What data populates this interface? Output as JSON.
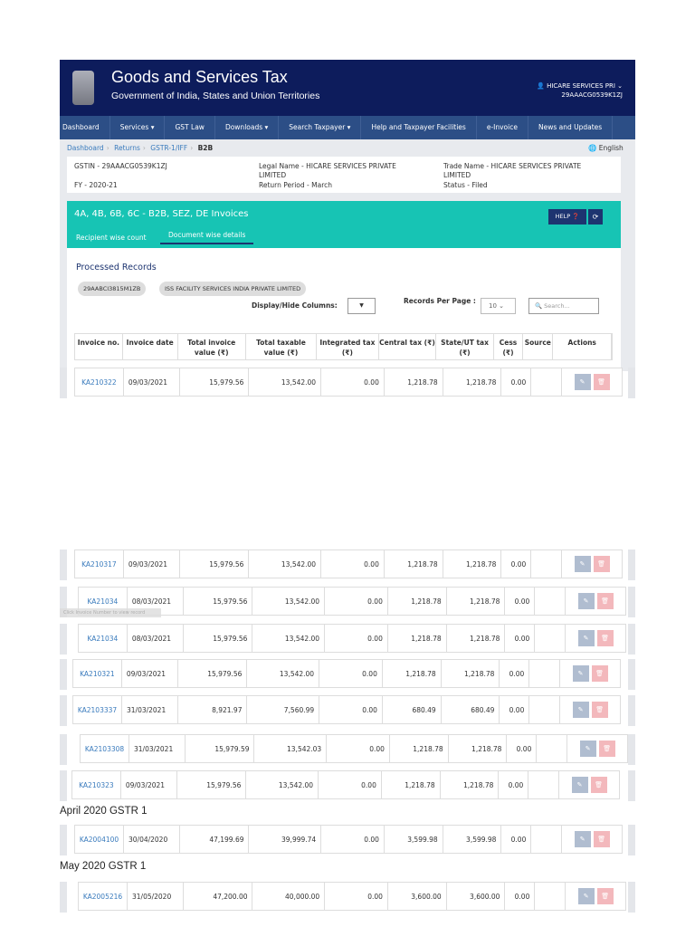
{
  "header": {
    "title": "Goods and Services Tax",
    "subtitle": "Government of India, States and Union Territories",
    "user_name": "HICARE SERVICES PRI ⌄",
    "user_gstin": "29AAACG0539K1ZJ"
  },
  "nav": [
    "Dashboard",
    "Services ▾",
    "GST Law",
    "Downloads ▾",
    "Search Taxpayer ▾",
    "Help and Taxpayer Facilities",
    "e-Invoice",
    "News and Updates"
  ],
  "breadcrumb": [
    "Dashboard",
    "Returns",
    "GSTR-1/IFF",
    "B2B"
  ],
  "language": "English",
  "info": {
    "gstin": "GSTIN - 29AAACG0539K1ZJ",
    "fy": "FY - 2020-21",
    "legal_name": "Legal Name - HICARE SERVICES PRIVATE LIMITED",
    "return_period": "Return Period - March",
    "trade_name": "Trade Name - HICARE SERVICES PRIVATE LIMITED",
    "status": "Status - Filed"
  },
  "panel": {
    "title": "4A, 4B, 6B, 6C - B2B, SEZ, DE Invoices",
    "help": "HELP ❓",
    "tabs": [
      "Recipient wise count",
      "Document wise details"
    ],
    "processed": "Processed Records",
    "chips": [
      "29AABCI3815M1ZB",
      "ISS FACILITY SERVICES INDIA PRIVATE LIMITED"
    ],
    "display_hide": "Display/Hide Columns:",
    "records_per_page": "Records Per Page :",
    "rpp_value": "10",
    "search_placeholder": "Search..."
  },
  "columns": [
    "Invoice no.",
    "Invoice date",
    "Total invoice value (₹)",
    "Total taxable value (₹)",
    "Integrated tax (₹)",
    "Central tax (₹)",
    "State/UT tax (₹)",
    "Cess (₹)",
    "Source",
    "Actions"
  ],
  "rows": [
    [
      "KA210322",
      "09/03/2021",
      "15,979.56",
      "13,542.00",
      "0.00",
      "1,218.78",
      "1,218.78",
      "0.00"
    ],
    [
      "KA210317",
      "09/03/2021",
      "15,979.56",
      "13,542.00",
      "0.00",
      "1,218.78",
      "1,218.78",
      "0.00"
    ],
    [
      "KA21034",
      "08/03/2021",
      "15,979.56",
      "13,542.00",
      "0.00",
      "1,218.78",
      "1,218.78",
      "0.00"
    ],
    [
      "KA21034",
      "08/03/2021",
      "15,979.56",
      "13,542.00",
      "0.00",
      "1,218.78",
      "1,218.78",
      "0.00"
    ],
    [
      "KA210321",
      "09/03/2021",
      "15,979.56",
      "13,542.00",
      "0.00",
      "1,218.78",
      "1,218.78",
      "0.00"
    ],
    [
      "KA2103337",
      "31/03/2021",
      "8,921.97",
      "7,560.99",
      "0.00",
      "680.49",
      "680.49",
      "0.00"
    ],
    [
      "KA2103308",
      "31/03/2021",
      "15,979.59",
      "13,542.03",
      "0.00",
      "1,218.78",
      "1,218.78",
      "0.00"
    ],
    [
      "KA210323",
      "09/03/2021",
      "15,979.56",
      "13,542.00",
      "0.00",
      "1,218.78",
      "1,218.78",
      "0.00"
    ],
    [
      "KA2004100",
      "30/04/2020",
      "47,199.69",
      "39,999.74",
      "0.00",
      "3,599.98",
      "3,599.98",
      "0.00"
    ],
    [
      "KA2005216",
      "31/05/2020",
      "47,200.00",
      "40,000.00",
      "0.00",
      "3,600.00",
      "3,600.00",
      "0.00"
    ]
  ],
  "sections": [
    "April 2020 GSTR 1",
    "May 2020 GSTR 1"
  ],
  "tooltip": "Click Invoice Number to view record"
}
